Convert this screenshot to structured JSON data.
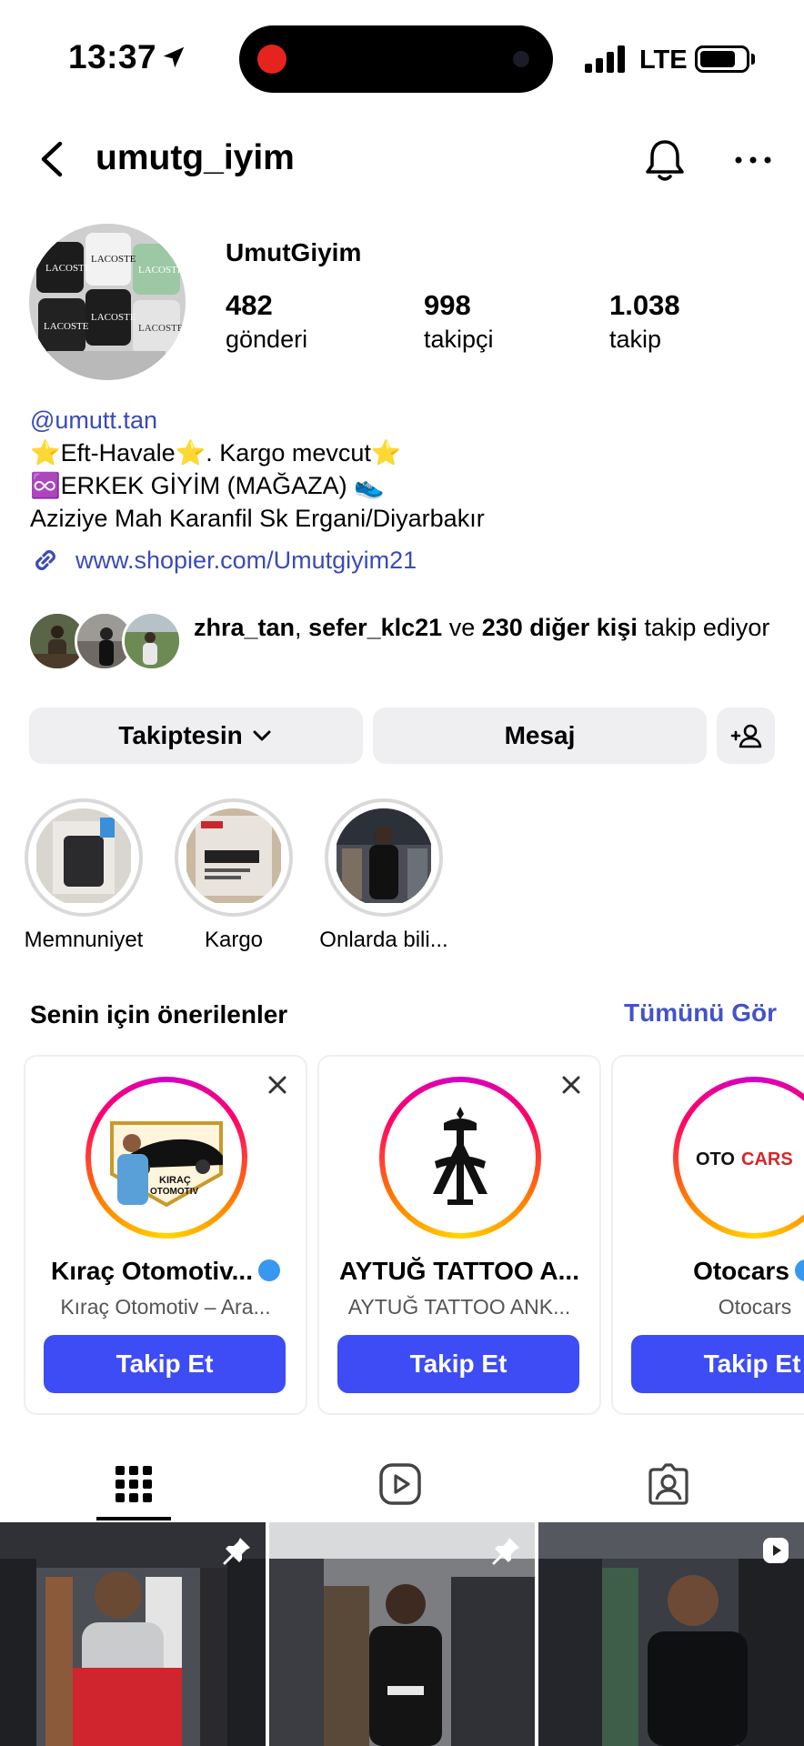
{
  "status_bar": {
    "time": "13:37",
    "network": "LTE"
  },
  "header": {
    "username": "umutg_iyim"
  },
  "profile": {
    "display_name": "UmutGiyim",
    "stats": [
      {
        "value": "482",
        "label": "gönderi"
      },
      {
        "value": "998",
        "label": "takipçi"
      },
      {
        "value": "1.038",
        "label": "takip"
      }
    ],
    "mention": "@umutt.tan",
    "bio_line1": "⭐Eft-Havale⭐. Kargo mevcut⭐",
    "bio_line2": "♾️ERKEK GİYİM (MAĞAZA) 👟",
    "bio_line3": "Aziziye Mah Karanfil Sk Ergani/Diyarbakır",
    "link": "www.shopier.com/Umutgiyim21"
  },
  "followed_by": {
    "user1": "zhra_tan",
    "comma": ", ",
    "user2": "sefer_klc21",
    "and": " ve ",
    "others": "230 diğer kişi",
    "suffix": " takip ediyor"
  },
  "actions": {
    "following_label": "Takiptesin",
    "message_label": "Mesaj"
  },
  "highlights": [
    {
      "label": "Memnuniyet"
    },
    {
      "label": "Kargo"
    },
    {
      "label": "Onlarda bili..."
    }
  ],
  "suggested": {
    "title": "Senin için önerilenler",
    "see_all": "Tümünü Gör",
    "cards": [
      {
        "name": "Kıraç Otomotiv...",
        "sub": "Kıraç Otomotiv – Ara...",
        "button": "Takip Et",
        "logo_text_1": "KIRAÇ",
        "logo_text_2": "OTOMOTIV"
      },
      {
        "name": "AYTUĞ TATTOO A...",
        "sub": "AYTUĞ TATTOO ANK...",
        "button": "Takip Et"
      },
      {
        "name": "Otocars",
        "sub": "Otocars",
        "button": "Takip Et",
        "logo_text_1": "OTO",
        "logo_text_2": "CARS"
      }
    ]
  },
  "avatar_text": "LACOSTE",
  "colors": {
    "accent": "#3d4cf4",
    "link": "#3a4bb8",
    "see_all": "#4553c6",
    "verified": "#3897f0"
  }
}
